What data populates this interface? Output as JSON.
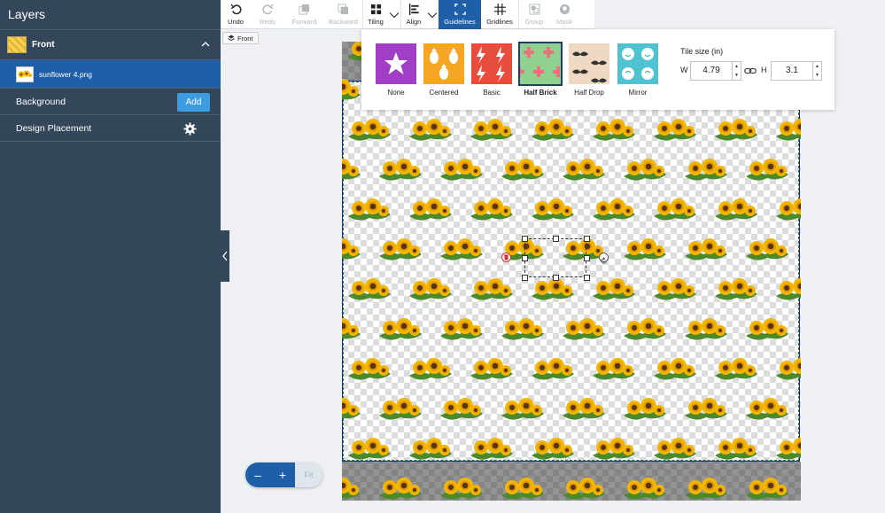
{
  "sidebar": {
    "title": "Layers",
    "front_label": "Front",
    "sub_label": "sunflower 4.png",
    "background_label": "Background",
    "add_label": "Add",
    "design_placement_label": "Design Placement"
  },
  "toolbar": {
    "undo": "Undo",
    "redo": "Redo",
    "forward": "Forward",
    "backward": "Backward",
    "tiling": "Tiling",
    "align": "Align",
    "guidelines": "Guidelines",
    "gridlines": "Gridlines",
    "group": "Group",
    "mask": "Mask"
  },
  "front_chip": "Front",
  "tiling": {
    "options": [
      "None",
      "Centered",
      "Basic",
      "Half Brick",
      "Half Drop",
      "Mirror"
    ],
    "selected": "Half Brick",
    "colors": [
      "#a03ec6",
      "#f5a623",
      "#e74c3c",
      "#8fd18f",
      "#f0d9c3",
      "#4fc3d1"
    ],
    "tile_size_title": "Tile size (in)",
    "w_label": "W",
    "h_label": "H",
    "width": "4.79",
    "height": "3.1"
  },
  "zoom": {
    "minus": "–",
    "plus": "+",
    "fit": "Fit"
  }
}
